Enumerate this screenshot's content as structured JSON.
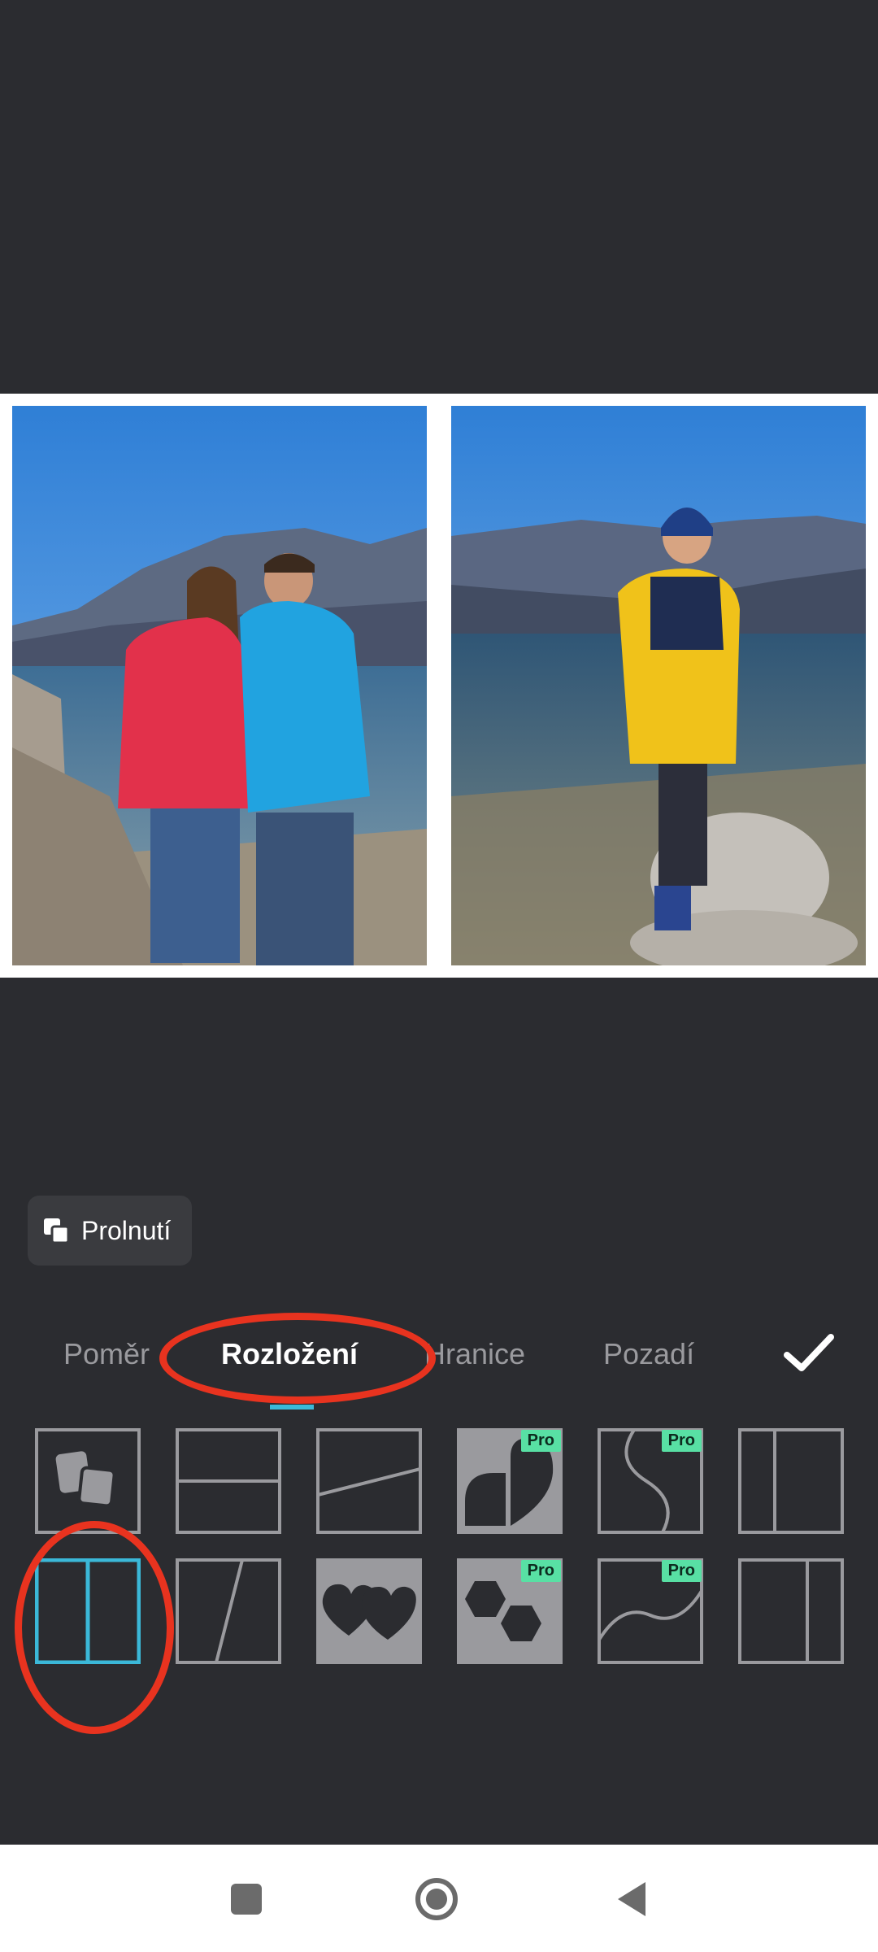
{
  "blend_button": {
    "label": "Prolnutí",
    "icon": "blend-icon"
  },
  "tabs": [
    {
      "label": "Poměr",
      "active": false
    },
    {
      "label": "Rozložení",
      "active": true
    },
    {
      "label": "Hranice",
      "active": false
    },
    {
      "label": "Pozadí",
      "active": false
    }
  ],
  "confirm_icon": "check-icon",
  "layouts_row1": [
    {
      "name": "freestyle",
      "pro": false
    },
    {
      "name": "horizontal-split",
      "pro": false
    },
    {
      "name": "diagonal-horizontal",
      "pro": false
    },
    {
      "name": "heart-shape",
      "pro": true
    },
    {
      "name": "s-curve",
      "pro": true
    },
    {
      "name": "vertical-split-right",
      "pro": false
    }
  ],
  "layouts_row2": [
    {
      "name": "vertical-split-selected",
      "pro": false,
      "selected": true
    },
    {
      "name": "diagonal-vertical",
      "pro": false
    },
    {
      "name": "two-hearts",
      "pro": false
    },
    {
      "name": "hexagons",
      "pro": true
    },
    {
      "name": "wave-curve",
      "pro": true
    },
    {
      "name": "vertical-split-right-2",
      "pro": false
    }
  ],
  "pro_badge": "Pro",
  "accent_color": "#3bb8d8",
  "annotation_color": "#e8331f",
  "nav": [
    "recent-apps-icon",
    "home-icon",
    "back-icon"
  ]
}
